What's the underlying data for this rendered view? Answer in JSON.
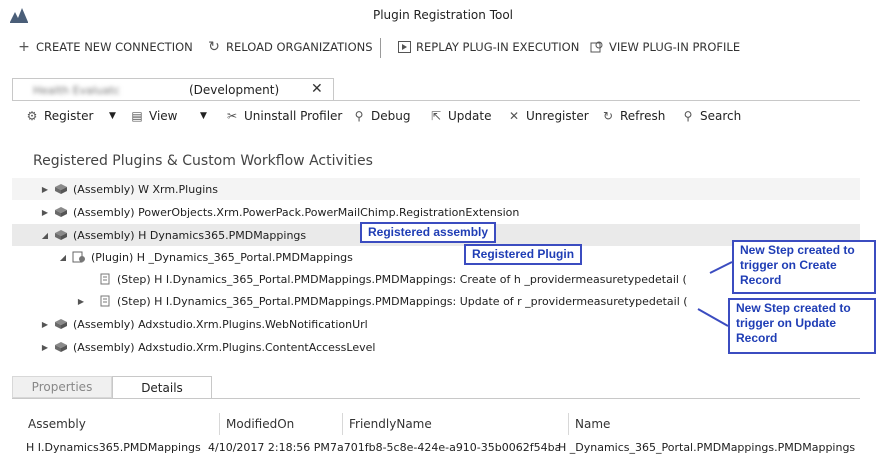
{
  "window": {
    "title": "Plugin Registration Tool",
    "logo_icon": "dynamics-logo-icon"
  },
  "main_toolbar": {
    "create_connection": "CREATE NEW CONNECTION",
    "reload_organizations": "RELOAD ORGANIZATIONS",
    "replay_execution": "REPLAY PLUG-IN EXECUTION",
    "view_profile": "VIEW PLUG-IN PROFILE"
  },
  "connection_tab": {
    "org_name_obscured": "Health Evaluatc",
    "environment": "(Development)",
    "close_glyph": "✕"
  },
  "command_bar": {
    "register": "Register",
    "view": "View",
    "uninstall_profiler": "Uninstall Profiler",
    "debug": "Debug",
    "update": "Update",
    "unregister": "Unregister",
    "refresh": "Refresh",
    "search": "Search"
  },
  "section_title": "Registered Plugins & Custom Workflow Activities",
  "tree": {
    "rows": [
      {
        "label": "(Assembly) W     Xrm.Plugins"
      },
      {
        "label": "(Assembly) PowerObjects.Xrm.PowerPack.PowerMailChimp.RegistrationExtension"
      },
      {
        "label": "(Assembly) H      Dynamics365.PMDMappings"
      },
      {
        "label": "(Plugin) H      _Dynamics_365_Portal.PMDMappings"
      },
      {
        "label": "(Step) H    I.Dynamics_365_Portal.PMDMappings.PMDMappings: Create of h   _providermeasuretypedetail ("
      },
      {
        "label": "(Step) H     I.Dynamics_365_Portal.PMDMappings.PMDMappings: Update of r   _providermeasuretypedetail ("
      },
      {
        "label": "(Assembly) Adxstudio.Xrm.Plugins.WebNotificationUrl"
      },
      {
        "label": "(Assembly) Adxstudio.Xrm.Plugins.ContentAccessLevel"
      }
    ]
  },
  "annotations": {
    "registered_assembly": "Registered assembly",
    "registered_plugin": "Registered Plugin",
    "step_create": "New Step created to trigger on Create Record",
    "step_update": "New Step created to trigger on Update Record"
  },
  "bottom_tabs": {
    "properties": "Properties",
    "details": "Details"
  },
  "details_grid": {
    "columns": [
      "Assembly",
      "ModifiedOn",
      "FriendlyName",
      "Name"
    ],
    "row": {
      "assembly": "H    I.Dynamics365.PMDMappings",
      "modified_on": "4/10/2017 2:18:56 PM",
      "friendly_name": "7a701fb8-5c8e-424e-a910-35b0062f54ba",
      "name": "H    _Dynamics_365_Portal.PMDMappings.PMDMappings"
    }
  },
  "colors": {
    "annotation_blue": "#3b4cc0",
    "selected_row": "#eaeaea"
  }
}
